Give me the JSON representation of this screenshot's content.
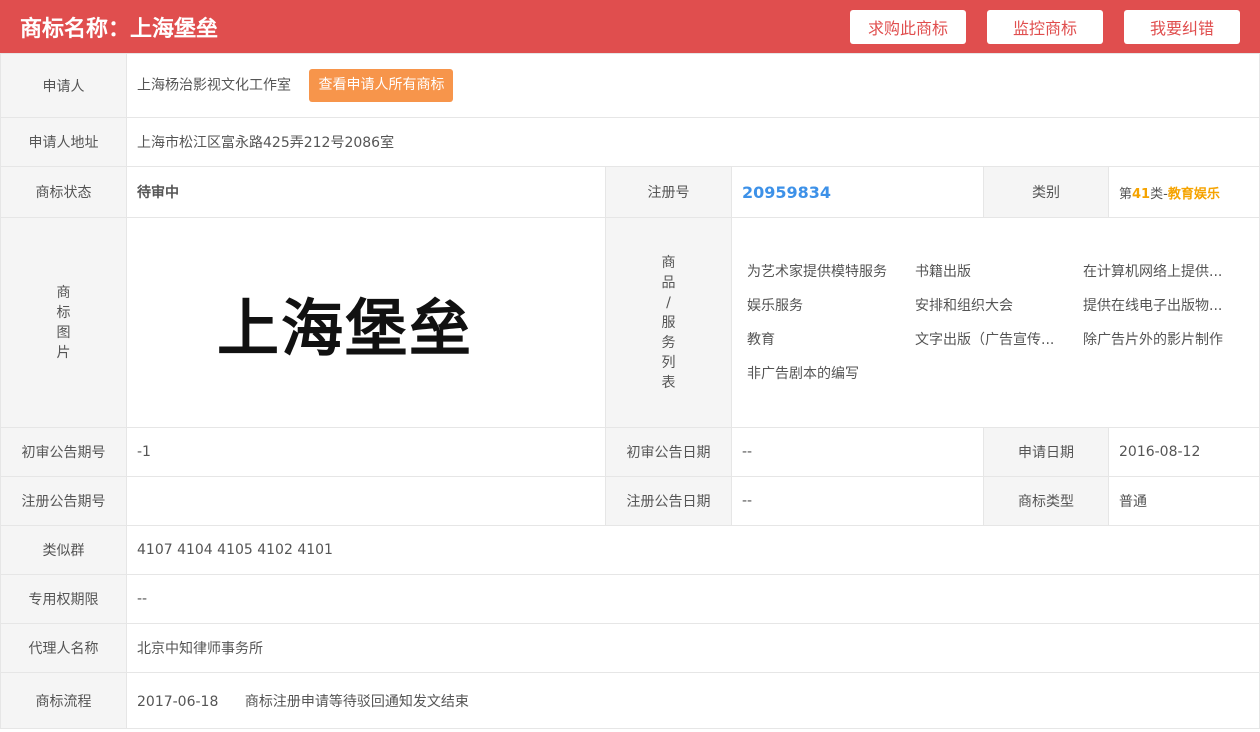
{
  "header": {
    "title": "商标名称：上海堡垒",
    "buttons": [
      "求购此商标",
      "监控商标",
      "我要纠错"
    ]
  },
  "applicant": {
    "label": "申请人",
    "value": "上海杨治影视文化工作室",
    "button": "查看申请人所有商标"
  },
  "address": {
    "label": "申请人地址",
    "value": "上海市松江区富永路425弄212号2086室"
  },
  "status": {
    "label": "商标状态",
    "value": "待审中"
  },
  "reg_no": {
    "label": "注册号",
    "value": "20959834"
  },
  "category": {
    "label": "类别",
    "prefix": "第",
    "number": "41",
    "suffix": "类-",
    "name": "教育娱乐"
  },
  "image": {
    "label_chars": [
      "商",
      "标",
      "图",
      "片"
    ],
    "mark_text": "上海堡垒"
  },
  "goods": {
    "label_chars": [
      "商",
      "品",
      "/",
      "服",
      "务",
      "列",
      "表"
    ],
    "items": [
      "为艺术家提供模特服务",
      "书籍出版",
      "在计算机网络上提供...",
      "娱乐服务",
      "安排和组织大会",
      "提供在线电子出版物...",
      "教育",
      "文字出版（广告宣传...",
      "除广告片外的影片制作",
      "非广告剧本的编写"
    ]
  },
  "prelim_issue": {
    "label": "初审公告期号",
    "value": "-1"
  },
  "prelim_date": {
    "label": "初审公告日期",
    "value": "--"
  },
  "apply_date": {
    "label": "申请日期",
    "value": "2016-08-12"
  },
  "reg_issue": {
    "label": "注册公告期号",
    "value": ""
  },
  "reg_date": {
    "label": "注册公告日期",
    "value": "--"
  },
  "mark_type": {
    "label": "商标类型",
    "value": "普通"
  },
  "similar_group": {
    "label": "类似群",
    "value": "4107 4104 4105 4102 4101"
  },
  "exclusive_period": {
    "label": "专用权期限",
    "value": "--"
  },
  "agent": {
    "label": "代理人名称",
    "value": "北京中知律师事务所"
  },
  "flow": {
    "label": "商标流程",
    "date": "2017-06-18",
    "text": "商标注册申请等待驳回通知发文结束"
  }
}
